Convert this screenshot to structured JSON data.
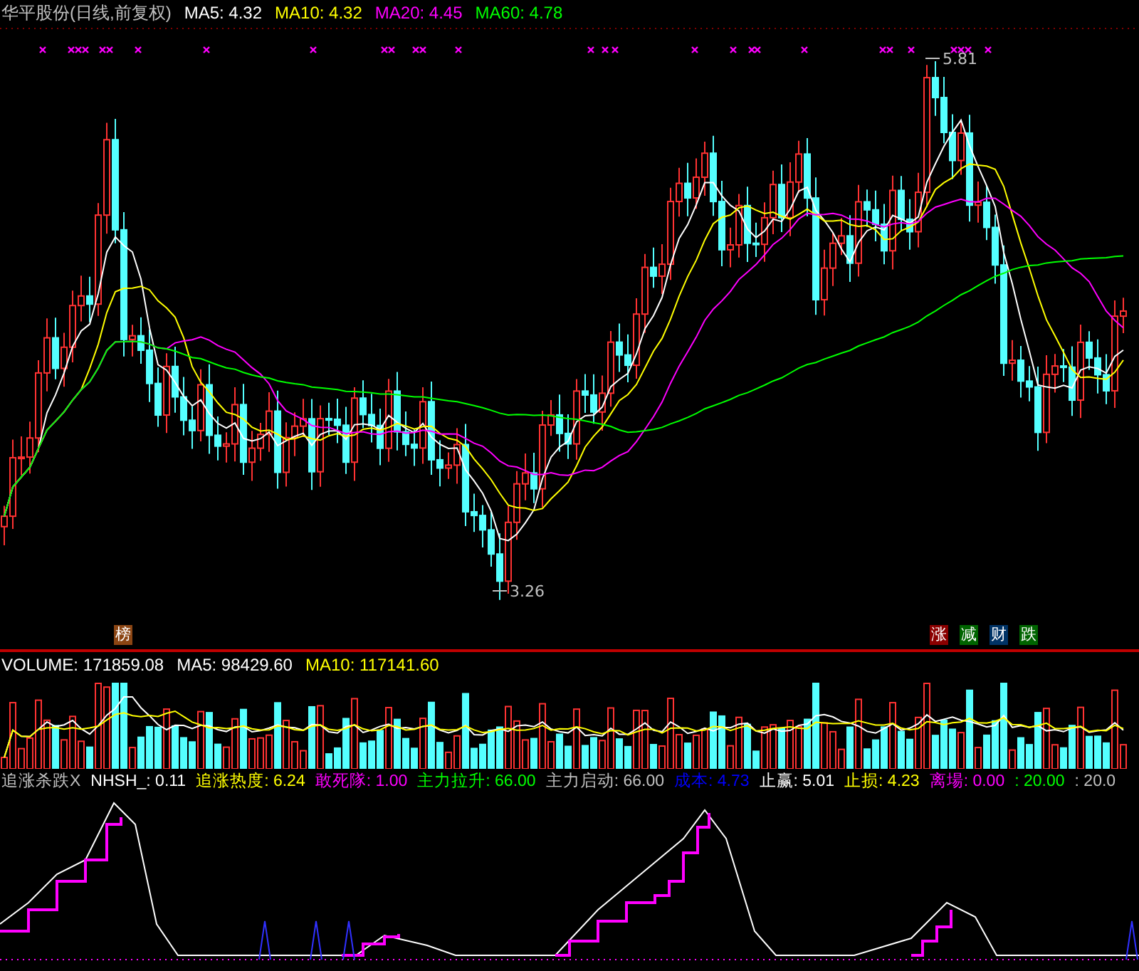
{
  "main_panel": {
    "title": "华平股份(日线,前复权)",
    "indicators": [
      {
        "label": "MA5: 4.32",
        "color": "#ffffff"
      },
      {
        "label": "MA10: 4.32",
        "color": "#ffff00"
      },
      {
        "label": "MA20: 4.45",
        "color": "#ff00ff"
      },
      {
        "label": "MA60: 4.78",
        "color": "#00ff00"
      }
    ],
    "high_label": "5.81",
    "low_label": "3.26",
    "badges": [
      {
        "text": "榜",
        "color": "#8b4513"
      },
      {
        "text": "涨",
        "color": "#8b0000"
      },
      {
        "text": "减",
        "color": "#006400"
      },
      {
        "text": "财",
        "color": "#003366"
      },
      {
        "text": "跌",
        "color": "#006400"
      }
    ]
  },
  "volume_panel": {
    "indicators": [
      {
        "label": "VOLUME: 171859.08",
        "color": "#ffffff"
      },
      {
        "label": "MA5: 98429.60",
        "color": "#ffffff"
      },
      {
        "label": "MA10: 117141.60",
        "color": "#ffff00"
      }
    ]
  },
  "indicator_panel": {
    "indicators": [
      {
        "label": "追涨杀跌X",
        "color": "#c0c0c0"
      },
      {
        "label": "NHSH_: 0.11",
        "color": "#ffffff"
      },
      {
        "label": "追涨热度: 6.24",
        "color": "#ffff00"
      },
      {
        "label": "敢死隊: 1.00",
        "color": "#ff00ff"
      },
      {
        "label": "主力拉升: 66.00",
        "color": "#00ff00"
      },
      {
        "label": "主力启动: 66.00",
        "color": "#c0c0c0"
      },
      {
        "label": "成本: 4.73",
        "color": "#0000ff"
      },
      {
        "label": "止赢: 5.01",
        "color": "#ffffff"
      },
      {
        "label": "止损: 4.23",
        "color": "#ffff00"
      },
      {
        "label": "离場: 0.00",
        "color": "#ff00ff"
      },
      {
        "label": ": 20.00",
        "color": "#00ff00"
      },
      {
        "label": ": 20.0",
        "color": "#c0c0c0"
      }
    ]
  }
}
